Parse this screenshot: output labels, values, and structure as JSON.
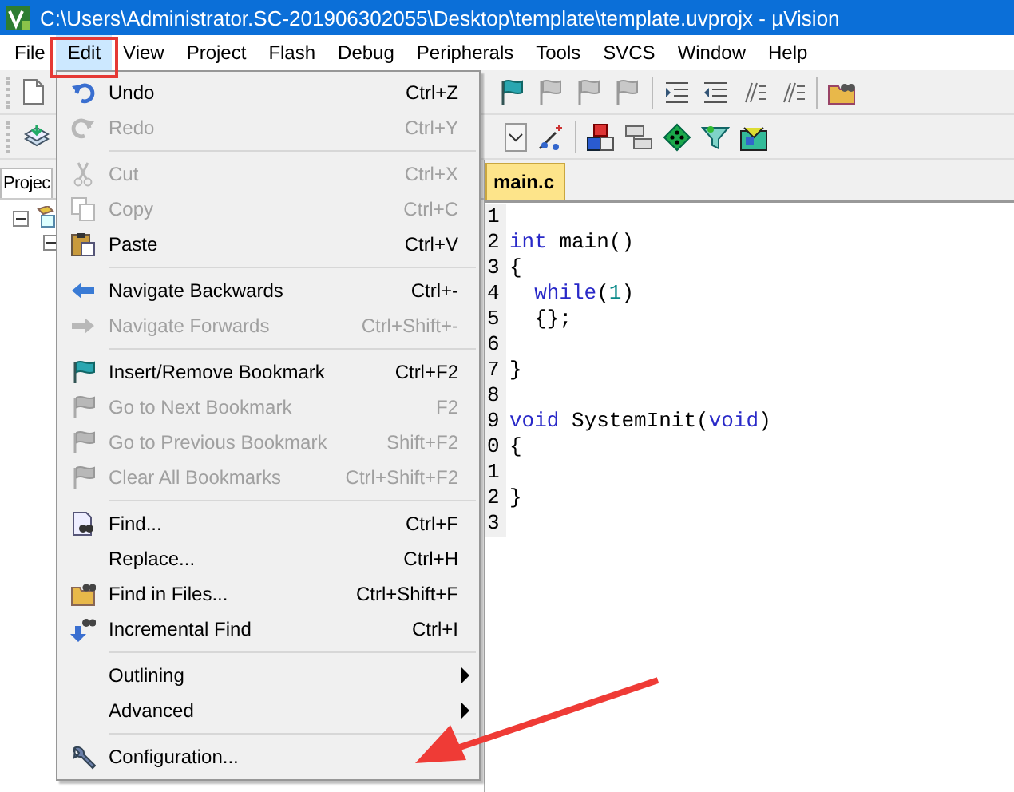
{
  "window": {
    "title": "C:\\Users\\Administrator.SC-201906302055\\Desktop\\template\\template.uvprojx - µVision"
  },
  "menu_bar": [
    {
      "label": "File",
      "selected": false
    },
    {
      "label": "Edit",
      "selected": true
    },
    {
      "label": "View",
      "selected": false
    },
    {
      "label": "Project",
      "selected": false
    },
    {
      "label": "Flash",
      "selected": false
    },
    {
      "label": "Debug",
      "selected": false
    },
    {
      "label": "Peripherals",
      "selected": false
    },
    {
      "label": "Tools",
      "selected": false
    },
    {
      "label": "SVCS",
      "selected": false
    },
    {
      "label": "Window",
      "selected": false
    },
    {
      "label": "Help",
      "selected": false
    }
  ],
  "project_panel": {
    "tab": "Projec"
  },
  "editor": {
    "tab": "main.c",
    "lines": [
      {
        "number": "1"
      },
      {
        "number": "2",
        "indented": false,
        "tokens": [
          {
            "text": "int",
            "kind": "keyword"
          },
          {
            "text": " main()",
            "kind": "plain"
          }
        ]
      },
      {
        "number": "3",
        "indented": false,
        "tokens": [
          {
            "text": "{",
            "kind": "plain"
          }
        ]
      },
      {
        "number": "4",
        "indented": true,
        "tokens": [
          {
            "text": "while",
            "kind": "keyword"
          },
          {
            "text": "(",
            "kind": "plain"
          },
          {
            "text": "1",
            "kind": "number"
          },
          {
            "text": ")",
            "kind": "plain"
          }
        ]
      },
      {
        "number": "5",
        "indented": true,
        "tokens": [
          {
            "text": "{};",
            "kind": "plain"
          }
        ]
      },
      {
        "number": "6"
      },
      {
        "number": "7",
        "indented": false,
        "tokens": [
          {
            "text": "}",
            "kind": "plain"
          }
        ]
      },
      {
        "number": "8"
      },
      {
        "number": "9",
        "indented": false,
        "tokens": [
          {
            "text": "void",
            "kind": "keyword"
          },
          {
            "text": " SystemInit(",
            "kind": "plain"
          },
          {
            "text": "void",
            "kind": "keyword"
          },
          {
            "text": ")",
            "kind": "plain"
          }
        ]
      },
      {
        "number": "0",
        "indented": false,
        "tokens": [
          {
            "text": "{",
            "kind": "plain"
          }
        ]
      },
      {
        "number": "1"
      },
      {
        "number": "2",
        "indented": false,
        "tokens": [
          {
            "text": "}",
            "kind": "plain"
          }
        ]
      },
      {
        "number": "3"
      }
    ]
  },
  "edit_menu": {
    "items": [
      {
        "kind": "item",
        "label": "Undo",
        "shortcut": "Ctrl+Z",
        "disabled": false
      },
      {
        "kind": "item",
        "label": "Redo",
        "shortcut": "Ctrl+Y",
        "disabled": true
      },
      {
        "kind": "separator"
      },
      {
        "kind": "item",
        "label": "Cut",
        "shortcut": "Ctrl+X",
        "disabled": true
      },
      {
        "kind": "item",
        "label": "Copy",
        "shortcut": "Ctrl+C",
        "disabled": true
      },
      {
        "kind": "item",
        "label": "Paste",
        "shortcut": "Ctrl+V",
        "disabled": false
      },
      {
        "kind": "separator"
      },
      {
        "kind": "item",
        "label": "Navigate Backwards",
        "shortcut": "Ctrl+-",
        "disabled": false
      },
      {
        "kind": "item",
        "label": "Navigate Forwards",
        "shortcut": "Ctrl+Shift+-",
        "disabled": true
      },
      {
        "kind": "separator"
      },
      {
        "kind": "item",
        "label": "Insert/Remove Bookmark",
        "shortcut": "Ctrl+F2",
        "disabled": false
      },
      {
        "kind": "item",
        "label": "Go to Next Bookmark",
        "shortcut": "F2",
        "disabled": true
      },
      {
        "kind": "item",
        "label": "Go to Previous Bookmark",
        "shortcut": "Shift+F2",
        "disabled": true
      },
      {
        "kind": "item",
        "label": "Clear All Bookmarks",
        "shortcut": "Ctrl+Shift+F2",
        "disabled": true
      },
      {
        "kind": "separator"
      },
      {
        "kind": "item",
        "label": "Find...",
        "shortcut": "Ctrl+F",
        "disabled": false
      },
      {
        "kind": "item",
        "label": "Replace...",
        "shortcut": "Ctrl+H",
        "disabled": false
      },
      {
        "kind": "item",
        "label": "Find in Files...",
        "shortcut": "Ctrl+Shift+F",
        "disabled": false
      },
      {
        "kind": "item",
        "label": "Incremental Find",
        "shortcut": "Ctrl+I",
        "disabled": false
      },
      {
        "kind": "separator"
      },
      {
        "kind": "submenu",
        "label": "Outlining",
        "disabled": false
      },
      {
        "kind": "submenu",
        "label": "Advanced",
        "disabled": false
      },
      {
        "kind": "separator"
      },
      {
        "kind": "item",
        "label": "Configuration...",
        "disabled": false
      }
    ]
  },
  "annotations": {
    "edit_highlight": true,
    "pointer_arrow": true
  }
}
